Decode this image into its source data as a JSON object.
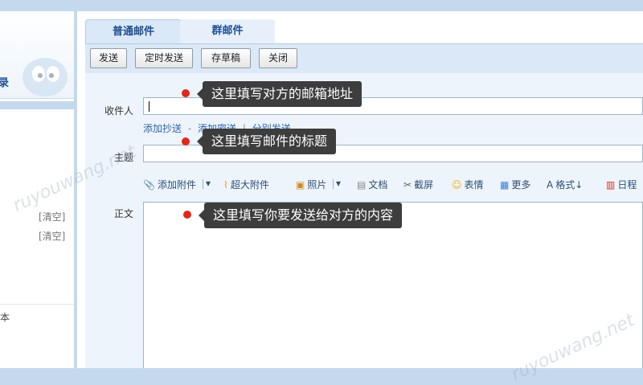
{
  "sidebar": {
    "top_text": "录",
    "clear_1": "[清空]",
    "clear_2": "[清空]",
    "bottom_text": "本"
  },
  "tabs": [
    {
      "label": "普通邮件",
      "active": true
    },
    {
      "label": "群邮件",
      "active": false
    }
  ],
  "toolbar": {
    "send": "发送",
    "scheduled_send": "定时发送",
    "save_draft": "存草稿",
    "close": "关闭"
  },
  "form": {
    "recipient_label": "收件人",
    "recipient_value": "",
    "cc_link": "添加抄送",
    "dash": "-",
    "bcc_link": "添加密送",
    "pipe": "|",
    "separate_send_link": "分别发送",
    "subject_label": "主题",
    "subject_value": "",
    "body_label": "正文"
  },
  "format_bar": {
    "attach": "添加附件",
    "large_attach": "超大附件",
    "photo": "照片",
    "doc": "文档",
    "screenshot": "截屏",
    "emoji": "表情",
    "more": "更多",
    "format": "格式↓",
    "schedule": "日程"
  },
  "callouts": {
    "recipient": "这里填写对方的邮箱地址",
    "subject": "这里填写邮件的标题",
    "body": "这里填写你要发送给对方的内容"
  },
  "watermark": {
    "text_1": "ruyouwang.net",
    "text_2": "ruyouwang.net"
  },
  "colors": {
    "accent": "#1d4f91",
    "toolbar_bg": "#dbe8f7",
    "callout_bg": "#3d3d3d",
    "callout_dot": "#e3261b"
  }
}
